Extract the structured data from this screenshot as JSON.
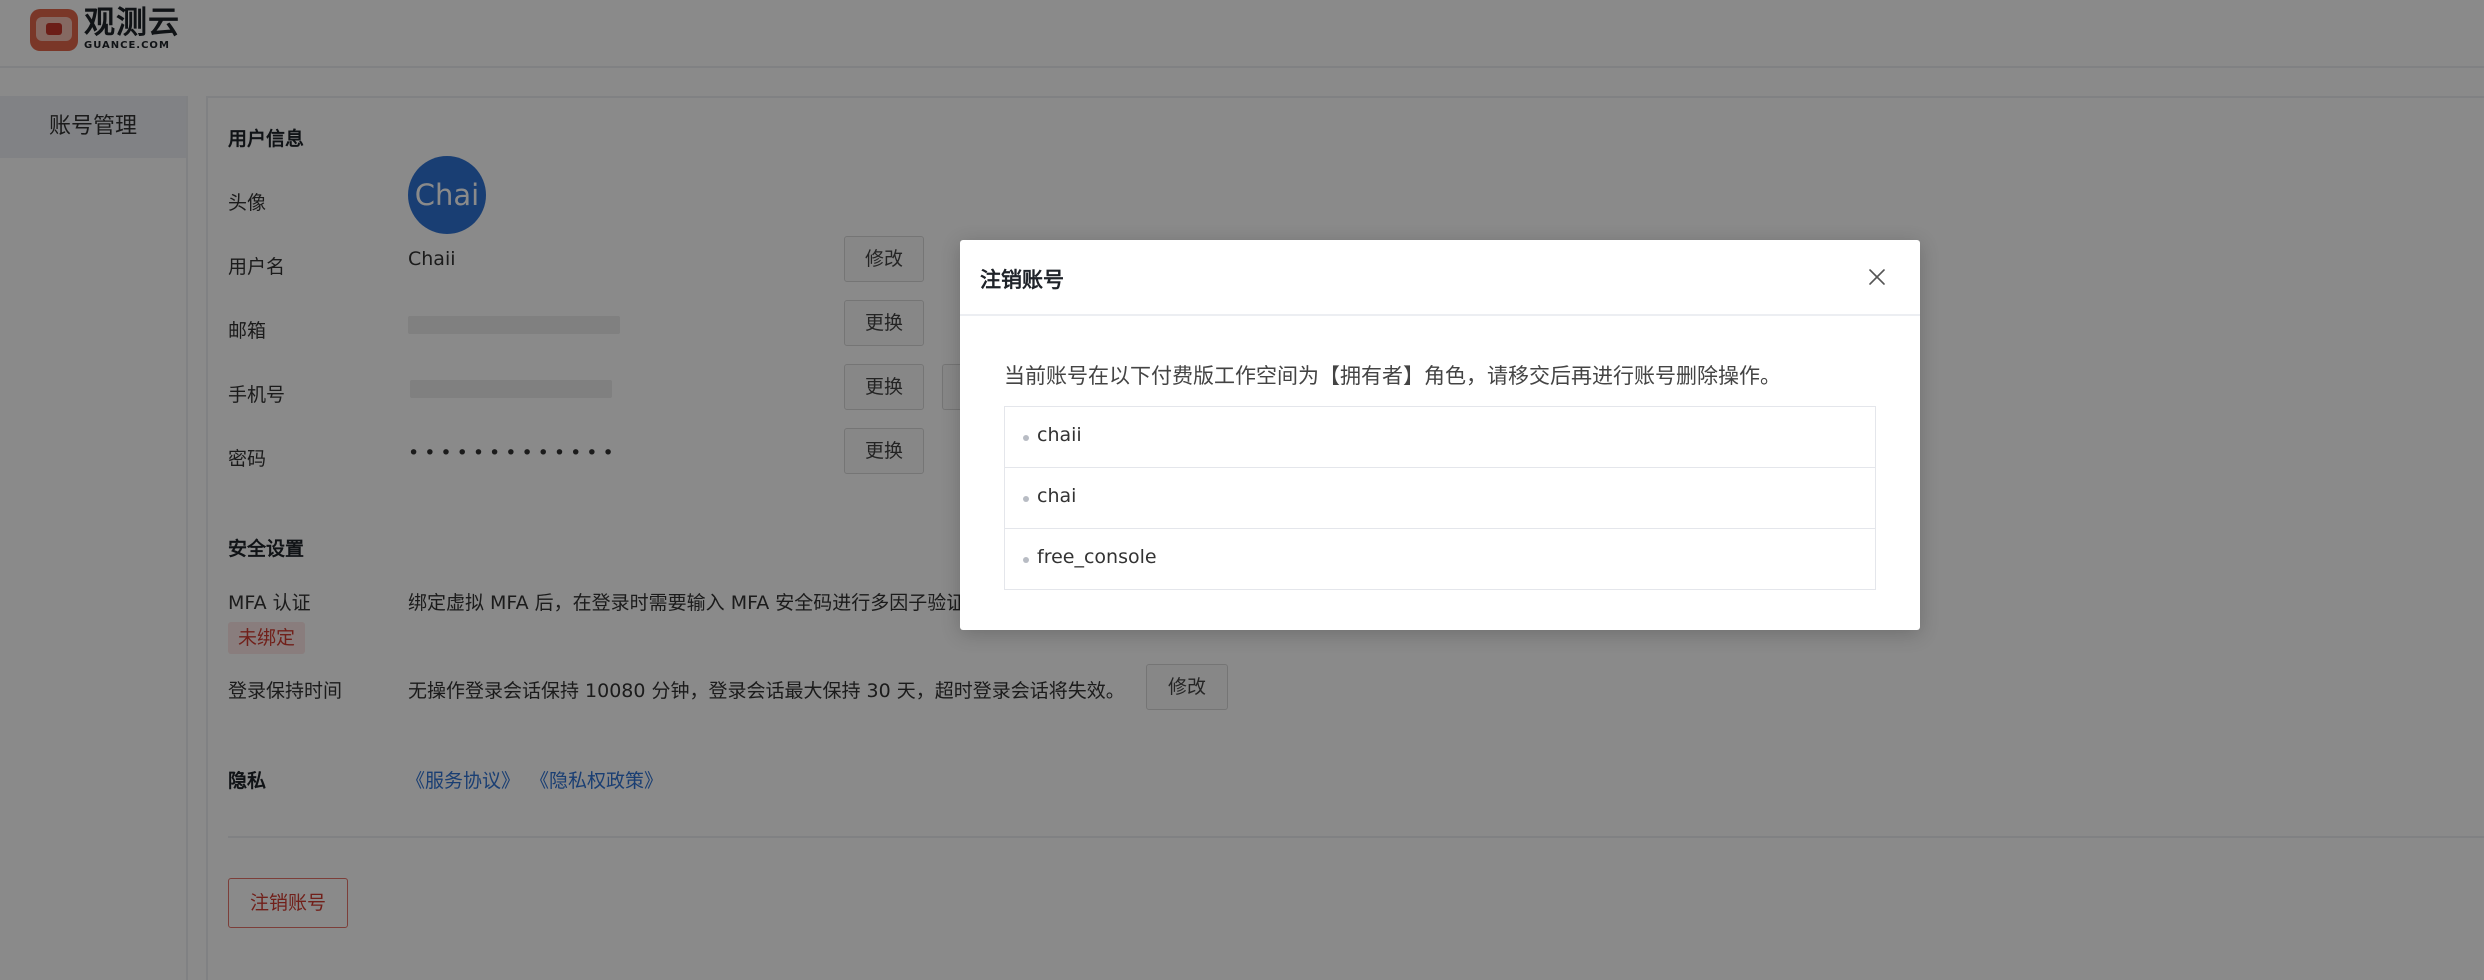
{
  "brand": {
    "cn": "观测云",
    "en": "GUANCE.COM"
  },
  "sidebar": {
    "items": [
      {
        "label": "账号管理"
      }
    ]
  },
  "user_info": {
    "title": "用户信息",
    "avatar_label": "头像",
    "avatar_text": "Chai",
    "username_label": "用户名",
    "username": "Chaii",
    "modify_label": "修改",
    "email_label": "邮箱",
    "change_label": "更换",
    "phone_label": "手机号",
    "password_label": "密码",
    "password_mask": "•••••••••••••"
  },
  "security": {
    "title": "安全设置",
    "mfa_label": "MFA 认证",
    "mfa_desc": "绑定虚拟 MFA 后，在登录时需要输入 MFA 安全码进行多因子验证",
    "mfa_status": "未绑定",
    "session_label": "登录保持时间",
    "session_desc": "无操作登录会话保持 10080 分钟，登录会话最大保持 30 天，超时登录会话将失效。",
    "session_modify": "修改"
  },
  "privacy": {
    "title": "隐私",
    "service_link": "《服务协议》",
    "privacy_link": "《隐私权政策》"
  },
  "delete_account_button": "注销账号",
  "modal": {
    "title": "注销账号",
    "message": "当前账号在以下付费版工作空间为【拥有者】角色，请移交后再进行账号删除操作。",
    "workspaces": [
      "chaii",
      "chai",
      "free_console"
    ]
  },
  "colors": {
    "accent": "#2f73d4",
    "danger": "#d13b30",
    "overlay": "rgba(0,0,0,0.46)"
  }
}
